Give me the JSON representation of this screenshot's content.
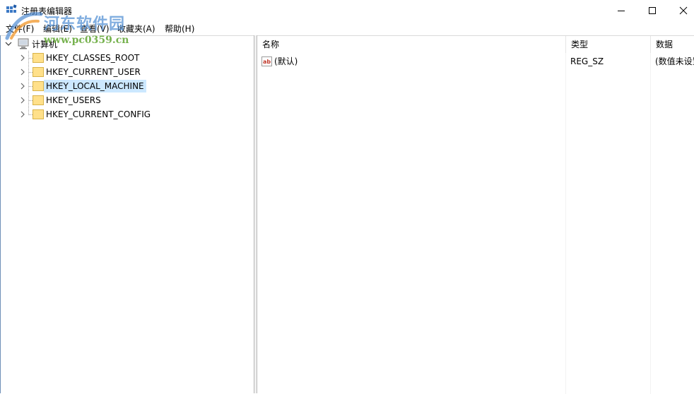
{
  "window": {
    "title": "注册表编辑器",
    "icon": "registry-editor-icon",
    "controls": [
      "minimize-icon",
      "maximize-icon",
      "close-icon"
    ]
  },
  "menu": {
    "items": [
      {
        "label": "文件(F)"
      },
      {
        "label": "编辑(E)"
      },
      {
        "label": "查看(V)"
      },
      {
        "label": "收藏夹(A)"
      },
      {
        "label": "帮助(H)"
      }
    ]
  },
  "watermark": {
    "title": "河东软件园",
    "url": "www.pc0359.cn"
  },
  "tree": {
    "root": {
      "label": "计算机",
      "expanded": true
    },
    "children": [
      {
        "label": "HKEY_CLASSES_ROOT",
        "selected": false
      },
      {
        "label": "HKEY_CURRENT_USER",
        "selected": false
      },
      {
        "label": "HKEY_LOCAL_MACHINE",
        "selected": true
      },
      {
        "label": "HKEY_USERS",
        "selected": false
      },
      {
        "label": "HKEY_CURRENT_CONFIG",
        "selected": false
      }
    ]
  },
  "values": {
    "columns": {
      "name": "名称",
      "type": "类型",
      "data": "数据"
    },
    "rows": [
      {
        "name": "(默认)",
        "type": "REG_SZ",
        "data": "(数值未设置)"
      }
    ]
  },
  "colors": {
    "selection": "#cce8ff",
    "folder": "#ffe08a",
    "folder_edge": "#d9b34a",
    "watermark_blue": "#5c96d6",
    "watermark_green": "#68aa3c"
  }
}
